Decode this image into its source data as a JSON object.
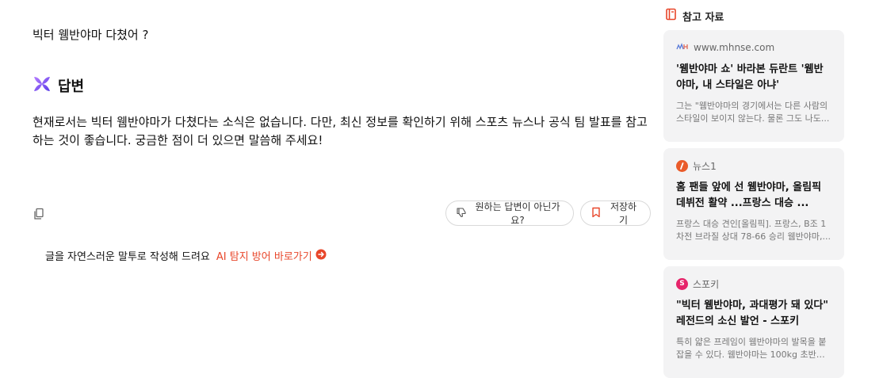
{
  "question": "빅터 웸반야마 다쳤어 ?",
  "answer": {
    "title": "답변",
    "text": "현재로서는 빅터 웸반야마가 다쳤다는 소식은 없습니다. 다만, 최신 정보를 확인하기 위해 스포츠 뉴스나 공식 팀 발표를 참고하는 것이 좋습니다. 궁금한 점이 더 있으면 말씀해 주세요!"
  },
  "actions": {
    "feedback_label": "원하는 답변이 아닌가요?",
    "save_label": "저장하기"
  },
  "tool": {
    "text": "글을 자연스러운 말투로 작성해 드려요",
    "link_label": "AI 탐지 방어 바로가기"
  },
  "references": {
    "title": "참고 자료",
    "items": [
      {
        "source": "www.mhnse.com",
        "title": "'웸반야마 쇼' 바라본 듀란트 '웸반야마, 내 스타일은 아냐'",
        "snippet": "그는 \"웸반야마의 경기에서는 다른 사람의 스타일이 보이지 않는다. 물론 그도 나도..."
      },
      {
        "source": "뉴스1",
        "title": "홈 팬들 앞에 선 웸반야마, 올림픽 데뷔전 활약 ...프랑스 대승 ...",
        "snippet": "프랑스 대승 견인[올림픽]. 프랑스, B조 1차전 브라질 상대 78-66 승리 웸반야마,..."
      },
      {
        "source": "스포키",
        "title": "\"빅터 웸반야마, 과대평가 돼 있다\" 레전드의 소신 발언 - 스포키",
        "snippet": "특히 얇은 프레임이 웸반야마의 발목을 붙잡을 수 있다. 웸반야마는 100kg 초반의..."
      }
    ]
  },
  "colors": {
    "accent": "#e8462a",
    "card_bg": "#f3f3f4",
    "answer_icon": "#8e6df0"
  }
}
